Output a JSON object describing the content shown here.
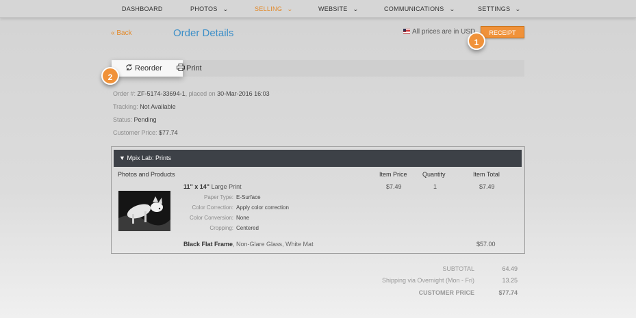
{
  "nav": [
    {
      "label": "DASHBOARD",
      "dropdown": false,
      "active": false
    },
    {
      "label": "PHOTOS",
      "dropdown": true,
      "active": false
    },
    {
      "label": "SELLING",
      "dropdown": true,
      "active": true
    },
    {
      "label": "WEBSITE",
      "dropdown": true,
      "active": false
    },
    {
      "label": "COMMUNICATIONS",
      "dropdown": true,
      "active": false
    },
    {
      "label": "SETTINGS",
      "dropdown": true,
      "active": false
    }
  ],
  "header": {
    "back_label": "« Back",
    "title": "Order Details",
    "prices_note": "All prices are in USD",
    "receipt_label": "RECEIPT"
  },
  "badges": {
    "one": "1",
    "two": "2"
  },
  "actions": {
    "reorder_label": "Reorder",
    "print_label": "Print"
  },
  "order": {
    "order_label": "Order #:",
    "order_number": "ZF-5174-33694-1",
    "placed_label": ", placed on",
    "placed_date": "30-Mar-2016 16:03",
    "tracking_label": "Tracking:",
    "tracking_value": "Not Available",
    "status_label": "Status:",
    "status_value": "Pending",
    "customer_price_label": "Customer Price:",
    "customer_price_value": "$77.74"
  },
  "lab": {
    "name": "Mpix Lab: Prints",
    "columns": {
      "products": "Photos and Products",
      "item_price": "Item Price",
      "quantity": "Quantity",
      "item_total": "Item Total"
    },
    "item": {
      "size": "11\" x 14\"",
      "name": "Large Print",
      "item_price": "$7.49",
      "quantity": "1",
      "item_total": "$7.49",
      "attributes": [
        {
          "label": "Paper Type:",
          "value": "E-Surface"
        },
        {
          "label": "Color Correction:",
          "value": "Apply color correction"
        },
        {
          "label": "Color Conversion:",
          "value": "None"
        },
        {
          "label": "Cropping:",
          "value": "Centered"
        }
      ]
    },
    "frame": {
      "name": "Black Flat Frame",
      "details": ", Non-Glare Glass, White Mat",
      "total": "$57.00"
    }
  },
  "summary": {
    "subtotal_label": "SUBTOTAL",
    "subtotal_value": "64.49",
    "shipping_label": "Shipping via Overnight (Mon - Fri)",
    "shipping_value": "13.25",
    "customer_price_label": "CUSTOMER PRICE",
    "customer_price_value": "$77.74"
  },
  "colors": {
    "accent_orange": "#f0923a",
    "title_blue": "#3d8fc8",
    "lab_header": "#3d4147"
  }
}
